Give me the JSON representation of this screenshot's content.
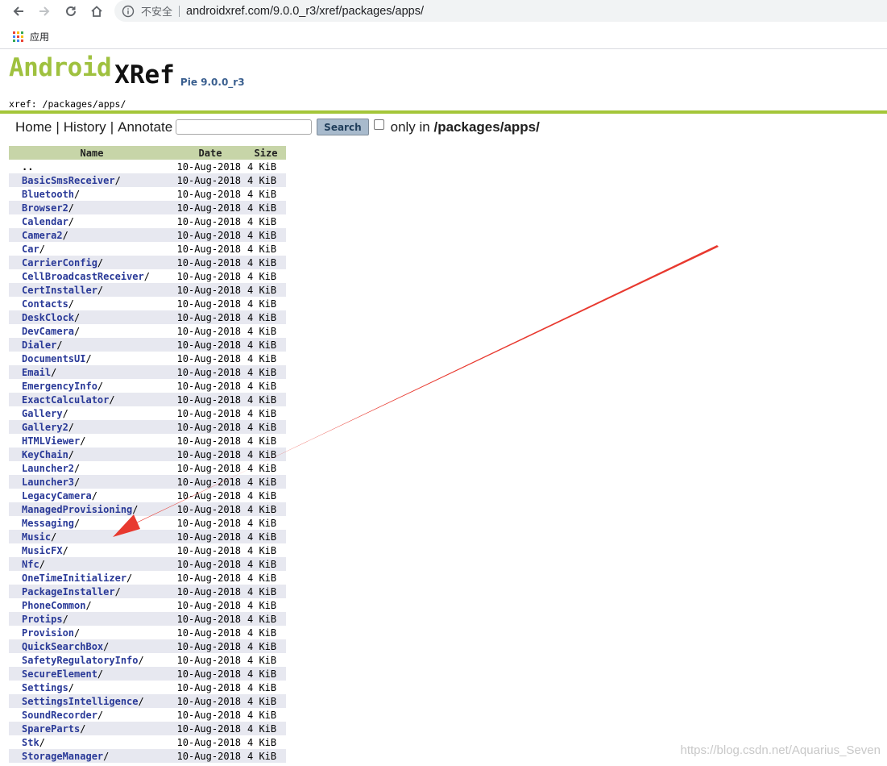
{
  "browser": {
    "security_label": "不安全",
    "url": "androidxref.com/9.0.0_r3/xref/packages/apps/",
    "bookmark_apps_label": "应用"
  },
  "header": {
    "logo_android": "Android",
    "logo_xref": "XRef",
    "version": "Pie 9.0.0_r3",
    "breadcrumb": "xref: /packages/apps/"
  },
  "menu": {
    "home": "Home",
    "history": "History",
    "annotate": "Annotate",
    "separator": "|",
    "search_value": "",
    "search_button": "Search",
    "only_in_prefix": "only in",
    "only_in_path": "/packages/apps/"
  },
  "table": {
    "headers": [
      "Name",
      "Date",
      "Size"
    ],
    "rows": [
      {
        "name": "..",
        "slash": "",
        "date": "10-Aug-2018",
        "size": "4 KiB"
      },
      {
        "name": "BasicSmsReceiver",
        "slash": "/",
        "date": "10-Aug-2018",
        "size": "4 KiB"
      },
      {
        "name": "Bluetooth",
        "slash": "/",
        "date": "10-Aug-2018",
        "size": "4 KiB"
      },
      {
        "name": "Browser2",
        "slash": "/",
        "date": "10-Aug-2018",
        "size": "4 KiB"
      },
      {
        "name": "Calendar",
        "slash": "/",
        "date": "10-Aug-2018",
        "size": "4 KiB"
      },
      {
        "name": "Camera2",
        "slash": "/",
        "date": "10-Aug-2018",
        "size": "4 KiB"
      },
      {
        "name": "Car",
        "slash": "/",
        "date": "10-Aug-2018",
        "size": "4 KiB"
      },
      {
        "name": "CarrierConfig",
        "slash": "/",
        "date": "10-Aug-2018",
        "size": "4 KiB"
      },
      {
        "name": "CellBroadcastReceiver",
        "slash": "/",
        "date": "10-Aug-2018",
        "size": "4 KiB"
      },
      {
        "name": "CertInstaller",
        "slash": "/",
        "date": "10-Aug-2018",
        "size": "4 KiB"
      },
      {
        "name": "Contacts",
        "slash": "/",
        "date": "10-Aug-2018",
        "size": "4 KiB"
      },
      {
        "name": "DeskClock",
        "slash": "/",
        "date": "10-Aug-2018",
        "size": "4 KiB"
      },
      {
        "name": "DevCamera",
        "slash": "/",
        "date": "10-Aug-2018",
        "size": "4 KiB"
      },
      {
        "name": "Dialer",
        "slash": "/",
        "date": "10-Aug-2018",
        "size": "4 KiB"
      },
      {
        "name": "DocumentsUI",
        "slash": "/",
        "date": "10-Aug-2018",
        "size": "4 KiB"
      },
      {
        "name": "Email",
        "slash": "/",
        "date": "10-Aug-2018",
        "size": "4 KiB"
      },
      {
        "name": "EmergencyInfo",
        "slash": "/",
        "date": "10-Aug-2018",
        "size": "4 KiB"
      },
      {
        "name": "ExactCalculator",
        "slash": "/",
        "date": "10-Aug-2018",
        "size": "4 KiB"
      },
      {
        "name": "Gallery",
        "slash": "/",
        "date": "10-Aug-2018",
        "size": "4 KiB"
      },
      {
        "name": "Gallery2",
        "slash": "/",
        "date": "10-Aug-2018",
        "size": "4 KiB"
      },
      {
        "name": "HTMLViewer",
        "slash": "/",
        "date": "10-Aug-2018",
        "size": "4 KiB"
      },
      {
        "name": "KeyChain",
        "slash": "/",
        "date": "10-Aug-2018",
        "size": "4 KiB"
      },
      {
        "name": "Launcher2",
        "slash": "/",
        "date": "10-Aug-2018",
        "size": "4 KiB"
      },
      {
        "name": "Launcher3",
        "slash": "/",
        "date": "10-Aug-2018",
        "size": "4 KiB"
      },
      {
        "name": "LegacyCamera",
        "slash": "/",
        "date": "10-Aug-2018",
        "size": "4 KiB"
      },
      {
        "name": "ManagedProvisioning",
        "slash": "/",
        "date": "10-Aug-2018",
        "size": "4 KiB"
      },
      {
        "name": "Messaging",
        "slash": "/",
        "date": "10-Aug-2018",
        "size": "4 KiB"
      },
      {
        "name": "Music",
        "slash": "/",
        "date": "10-Aug-2018",
        "size": "4 KiB"
      },
      {
        "name": "MusicFX",
        "slash": "/",
        "date": "10-Aug-2018",
        "size": "4 KiB"
      },
      {
        "name": "Nfc",
        "slash": "/",
        "date": "10-Aug-2018",
        "size": "4 KiB"
      },
      {
        "name": "OneTimeInitializer",
        "slash": "/",
        "date": "10-Aug-2018",
        "size": "4 KiB"
      },
      {
        "name": "PackageInstaller",
        "slash": "/",
        "date": "10-Aug-2018",
        "size": "4 KiB"
      },
      {
        "name": "PhoneCommon",
        "slash": "/",
        "date": "10-Aug-2018",
        "size": "4 KiB"
      },
      {
        "name": "Protips",
        "slash": "/",
        "date": "10-Aug-2018",
        "size": "4 KiB"
      },
      {
        "name": "Provision",
        "slash": "/",
        "date": "10-Aug-2018",
        "size": "4 KiB"
      },
      {
        "name": "QuickSearchBox",
        "slash": "/",
        "date": "10-Aug-2018",
        "size": "4 KiB"
      },
      {
        "name": "SafetyRegulatoryInfo",
        "slash": "/",
        "date": "10-Aug-2018",
        "size": "4 KiB"
      },
      {
        "name": "SecureElement",
        "slash": "/",
        "date": "10-Aug-2018",
        "size": "4 KiB"
      },
      {
        "name": "Settings",
        "slash": "/",
        "date": "10-Aug-2018",
        "size": "4 KiB"
      },
      {
        "name": "SettingsIntelligence",
        "slash": "/",
        "date": "10-Aug-2018",
        "size": "4 KiB"
      },
      {
        "name": "SoundRecorder",
        "slash": "/",
        "date": "10-Aug-2018",
        "size": "4 KiB"
      },
      {
        "name": "SpareParts",
        "slash": "/",
        "date": "10-Aug-2018",
        "size": "4 KiB"
      },
      {
        "name": "Stk",
        "slash": "/",
        "date": "10-Aug-2018",
        "size": "4 KiB"
      },
      {
        "name": "StorageManager",
        "slash": "/",
        "date": "10-Aug-2018",
        "size": "4 KiB"
      }
    ]
  },
  "annotation": {
    "arrow_color": "#e8392f",
    "points_to": "Music"
  },
  "watermark": "https://blog.csdn.net/Aquarius_Seven",
  "colors": {
    "android_green": "#a4c639",
    "link_blue": "#2a3a98",
    "header_bg": "#c7d5a8",
    "alt_row_bg": "#e7e8f0"
  }
}
